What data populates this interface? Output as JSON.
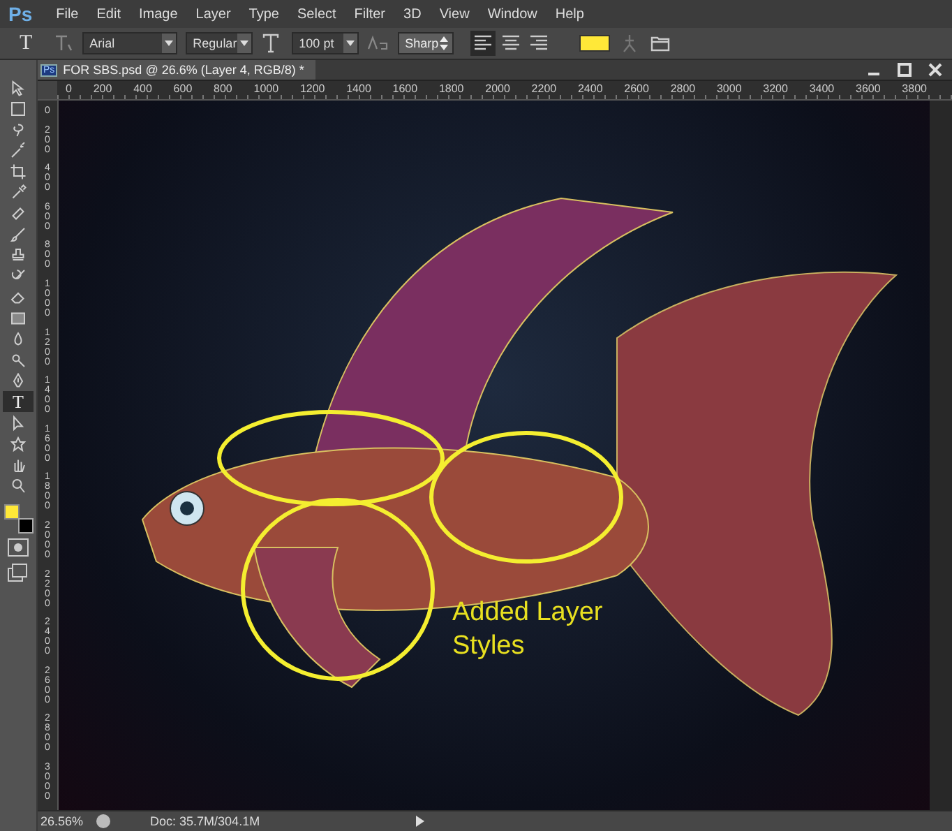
{
  "app_icon": "Ps",
  "menu": [
    "File",
    "Edit",
    "Image",
    "Layer",
    "Type",
    "Select",
    "Filter",
    "3D",
    "View",
    "Window",
    "Help"
  ],
  "options_bar": {
    "tool_glyph": "T",
    "font_family": "Arial",
    "font_style": "Regular",
    "font_size": "100 pt",
    "antialias": "Sharp",
    "alignment": [
      {
        "selected": true
      },
      {
        "selected": false
      },
      {
        "selected": false
      }
    ]
  },
  "document_tab": {
    "app_badge": "Ps",
    "title": "FOR SBS.psd @ 26.6% (Layer 4, RGB/8) *"
  },
  "ruler_h": [
    "0",
    "200",
    "400",
    "600",
    "800",
    "1000",
    "1200",
    "1400",
    "1600",
    "1800",
    "2000",
    "2200",
    "2400",
    "2600",
    "2800",
    "3000",
    "3200",
    "3400",
    "3600",
    "3800"
  ],
  "ruler_v": [
    "0",
    "200",
    "400",
    "600",
    "800",
    "1000",
    "1200",
    "1400",
    "1600",
    "1800",
    "2000",
    "2200",
    "2400",
    "2600",
    "2800",
    "3000"
  ],
  "tools": [
    {
      "kind": "move",
      "selected": false
    },
    {
      "kind": "marquee",
      "selected": false
    },
    {
      "kind": "lasso",
      "selected": false
    },
    {
      "kind": "wand",
      "selected": false
    },
    {
      "kind": "crop",
      "selected": false
    },
    {
      "kind": "eyedropper",
      "selected": false
    },
    {
      "kind": "bandage",
      "selected": false
    },
    {
      "kind": "brush",
      "selected": false
    },
    {
      "kind": "stamp",
      "selected": false
    },
    {
      "kind": "history",
      "selected": false
    },
    {
      "kind": "eraser",
      "selected": false
    },
    {
      "kind": "gradient",
      "selected": false
    },
    {
      "kind": "drop",
      "selected": false
    },
    {
      "kind": "dodge",
      "selected": false
    },
    {
      "kind": "pen",
      "selected": false
    },
    {
      "kind": "type",
      "glyph": "T",
      "selected": true
    },
    {
      "kind": "arrow",
      "selected": false
    },
    {
      "kind": "shape",
      "selected": false
    },
    {
      "kind": "hand",
      "selected": false
    },
    {
      "kind": "zoom",
      "selected": false
    }
  ],
  "canvas": {
    "annotation": "Added Layer Styles"
  },
  "status_bar": {
    "zoom": "26.56%",
    "doc_info": "Doc: 35.7M/304.1M"
  }
}
